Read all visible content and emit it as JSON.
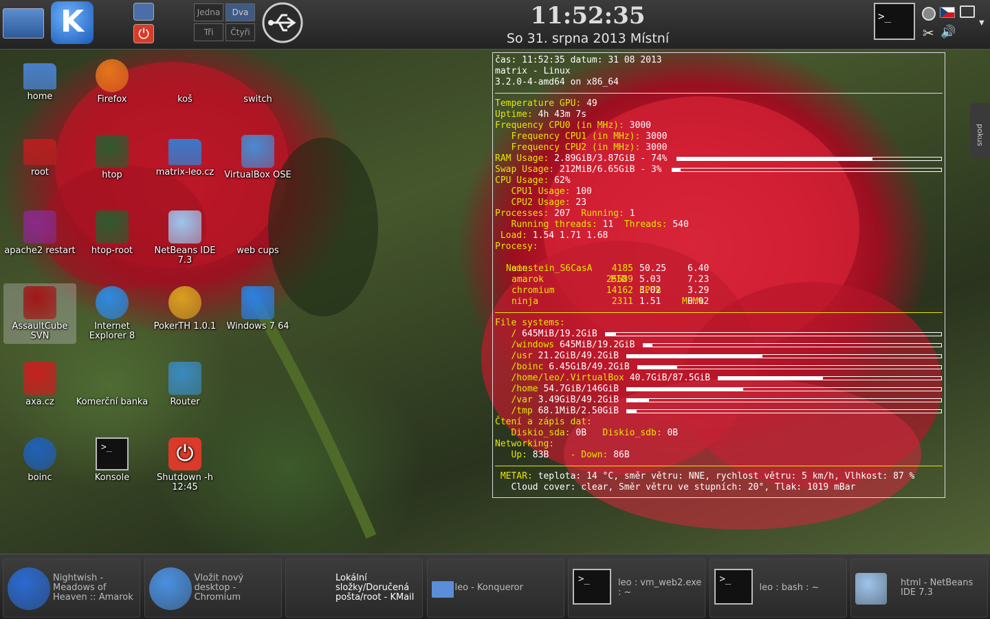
{
  "top_panel": {
    "clock_time": "11:52:35",
    "clock_date": "So 31. srpna 2013 Místní",
    "pager": [
      "Jedna",
      "Dva",
      "Tři",
      "Čtyři"
    ]
  },
  "desktop_icons": [
    {
      "label": "home",
      "icon": "home-folder-icon"
    },
    {
      "label": "Firefox",
      "icon": "firefox-icon"
    },
    {
      "label": "koš",
      "icon": "trash-icon"
    },
    {
      "label": "switch",
      "icon": "wireless-icon"
    },
    {
      "label": "root",
      "icon": "red-folder-icon"
    },
    {
      "label": "htop",
      "icon": "htop-icon"
    },
    {
      "label": "matrix-leo.cz",
      "icon": "network-folder-icon"
    },
    {
      "label": "VirtualBox OSE",
      "icon": "virtualbox-icon"
    },
    {
      "label": "apache2 restart",
      "icon": "apache-icon"
    },
    {
      "label": "htop-root",
      "icon": "htop-icon"
    },
    {
      "label": "NetBeans IDE 7.3",
      "icon": "netbeans-icon"
    },
    {
      "label": "web cups",
      "icon": "printer-icon"
    },
    {
      "label": "AssaultCube SVN",
      "icon": "assaultcube-icon"
    },
    {
      "label": "Internet Explorer 8",
      "icon": "ie-icon"
    },
    {
      "label": "PokerTH 1.0.1",
      "icon": "poker-chip-icon"
    },
    {
      "label": "Windows 7 64",
      "icon": "vbox-cube-icon"
    },
    {
      "label": "axa.cz",
      "icon": "abc-book-icon"
    },
    {
      "label": "Komerční banka",
      "icon": "calculator-icon"
    },
    {
      "label": "Router",
      "icon": "router-icon"
    },
    {
      "label": "boinc",
      "icon": "boinc-icon"
    },
    {
      "label": "Konsole",
      "icon": "terminal-icon"
    },
    {
      "label": "Shutdown -h 12:45",
      "icon": "shutdown-icon"
    }
  ],
  "conky": {
    "header": [
      "čas: 11:52:35 datum: 31 08 2013",
      "matrix - Linux",
      "3.2.0-4-amd64 on x86_64"
    ],
    "temp_label": "Temperature GPU:",
    "temp_val": "49",
    "uptime_label": "Uptime:",
    "uptime_val": "4h 43m 7s",
    "freq0_label": "Frequency CPU0 (in MHz):",
    "freq0_val": "3000",
    "freq1_label": "Frequency CPU1 (in MHz):",
    "freq1_val": "3000",
    "freq2_label": "Frequency CPU2 (in MHz):",
    "freq2_val": "3000",
    "ram_label": "RAM Usage:",
    "ram_val": "2.89GiB/3.87GiB - 74%",
    "ram_pct": 74,
    "swap_label": "Swap Usage:",
    "swap_val": "212MiB/6.65GiB - 3%",
    "swap_pct": 3,
    "cpu_label": "CPU Usage:",
    "cpu_val": "62%",
    "cpu1_label": "CPU1 Usage:",
    "cpu1_val": "100",
    "cpu2_label": "CPU2 Usage:",
    "cpu2_val": "23",
    "proc_label": "Processes:",
    "proc_val": "207",
    "run_label": "Running:",
    "run_val": "1",
    "rthreads_label": "Running threads:",
    "rthreads_val": "11",
    "threads_label": "Threads:",
    "threads_val": "540",
    "load_label": "Load:",
    "load_val": "1.54 1.71 1.68",
    "procesy_label": "Procesy:",
    "proc_headers": [
      "Name",
      "PID",
      "CPU%",
      "MEM%"
    ],
    "proc_rows": [
      [
        "einstein_S6CasA",
        "4185",
        "50.25",
        "6.40"
      ],
      [
        "amarok",
        "25589",
        "5.03",
        "7.23"
      ],
      [
        "chromium",
        "14162",
        "3.02",
        "3.29"
      ],
      [
        "ninja",
        "2311",
        "1.51",
        "0.02"
      ]
    ],
    "fs_label": "File systems:",
    "fs": [
      {
        "mount": "/",
        "val": "645MiB/19.2GiB",
        "pct": 3
      },
      {
        "mount": "/windows",
        "val": "645MiB/19.2GiB",
        "pct": 3
      },
      {
        "mount": "/usr",
        "val": "21.2GiB/49.2GiB",
        "pct": 43
      },
      {
        "mount": "/boinc",
        "val": "6.45GiB/49.2GiB",
        "pct": 13
      },
      {
        "mount": "/home/leo/.VirtualBox",
        "val": "40.7GiB/87.5GiB",
        "pct": 47
      },
      {
        "mount": "/home",
        "val": "54.7GiB/146GiB",
        "pct": 37
      },
      {
        "mount": "/var",
        "val": "3.49GiB/49.2GiB",
        "pct": 7
      },
      {
        "mount": "/tmp",
        "val": "68.1MiB/2.50GiB",
        "pct": 3
      }
    ],
    "io_label": "Čtení a zápis dat:",
    "sda_label": "Diskio_sda:",
    "sda_val": "0B",
    "sdb_label": "Diskio_sdb:",
    "sdb_val": "0B",
    "net_label": "Networking:",
    "up_label": "Up:",
    "up_val": "83B",
    "down_label": "- Down:",
    "down_val": "86B",
    "metar_label": "METAR:",
    "metar1": "teplota: 14 °C, směr větru: NNE, rychlost větru: 5 km/h, Vlhkost: 87 %",
    "metar2": "Cloud cover: clear, Směr větru ve stupních: 20°, Tlak: 1019 mBar"
  },
  "side_tab": "pokus",
  "tasks": [
    {
      "label": "Nightwish - Meadows of Heaven  ::  Amarok",
      "icon": "amarok-icon"
    },
    {
      "label": "Vložit nový desktop - Chromium",
      "icon": "chromium-icon"
    },
    {
      "label": "Lokální složky/Doručená pošta/root - KMail",
      "icon": "kmail-icon"
    },
    {
      "label": "leo - Konqueror",
      "icon": "konqueror-folder-icon"
    },
    {
      "label": "leo : vm_web2.exe : ~",
      "icon": "terminal-icon"
    },
    {
      "label": "leo : bash : ~",
      "icon": "terminal-icon"
    },
    {
      "label": "html - NetBeans IDE 7.3",
      "icon": "netbeans-icon"
    }
  ],
  "colors": {
    "conky_label": "#e6e600",
    "conky_value": "#ffffff",
    "panel": "#2c2c2c"
  }
}
